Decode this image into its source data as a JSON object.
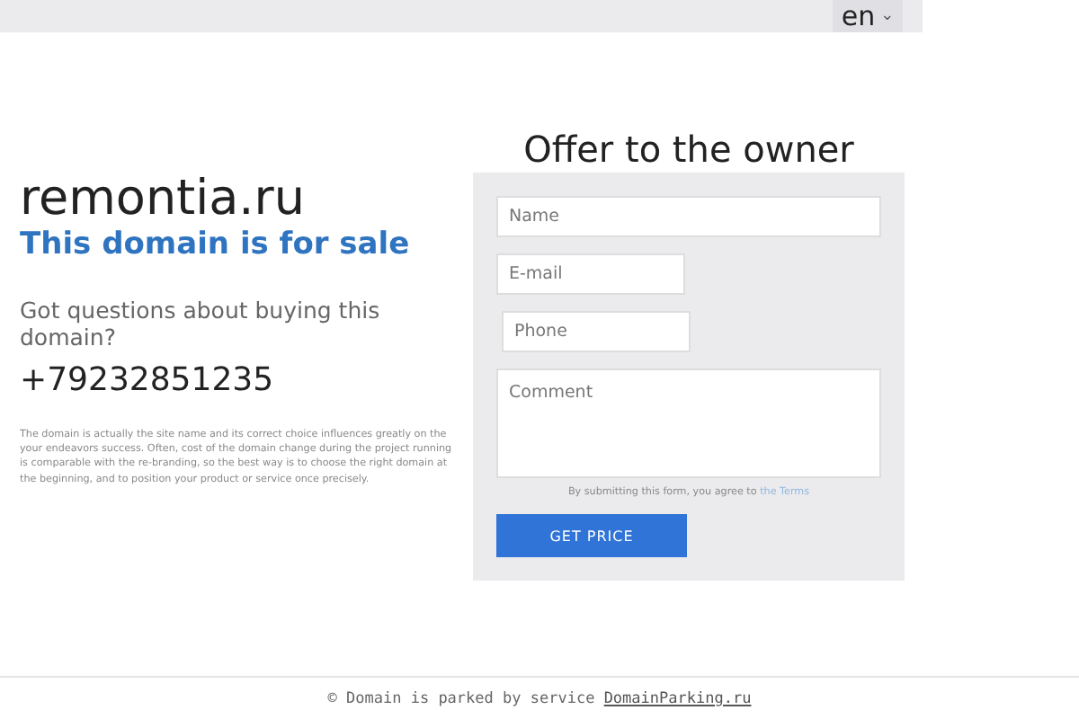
{
  "language": {
    "label": "en",
    "caret": "⌄"
  },
  "domain": "remontia.ru",
  "headline": "This domain is for sale",
  "question": "Got questions about buying this domain?",
  "phone": "+79232851235",
  "description": "The domain is actually the site name and its correct choice influences greatly on the your endeavors success. Often, cost of the domain change during the project running is comparable with the re-branding, so the best way is to choose the right domain at the beginning, and to position your product or service once precisely.",
  "form": {
    "title": "Offer to the owner",
    "fields": [
      {
        "kind": "input",
        "placeholder": "Name"
      },
      {
        "kind": "input",
        "placeholder": "E-mail"
      },
      {
        "kind": "input",
        "placeholder": "Phone"
      },
      {
        "kind": "textarea",
        "placeholder": "Comment"
      }
    ],
    "consent": "By submitting this form, you agree to",
    "terms_link": "the Terms",
    "submit": "GET PRICE"
  },
  "footer": {
    "text": "© Domain is parked by service",
    "link": "DomainParking.ru"
  }
}
